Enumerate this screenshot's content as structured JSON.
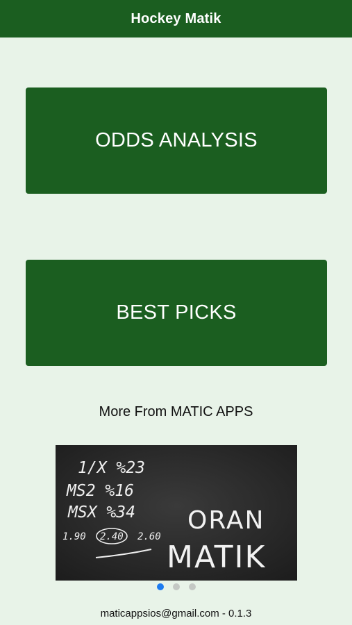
{
  "header": {
    "title": "Hockey Matik"
  },
  "menu": {
    "odds_label": "ODDS ANALYSIS",
    "picks_label": "BEST PICKS"
  },
  "promo": {
    "heading": "More From MATIC APPS",
    "banner_lines": [
      "1/X %23",
      "MS2 %16",
      "MSX %34",
      "1.90",
      "2.40",
      "2.60",
      "ORAN",
      "MATIK"
    ],
    "active_slide": 1,
    "slide_count": 3
  },
  "footer": {
    "text": "maticappsios@gmail.com - 0.1.3"
  },
  "colors": {
    "primary": "#1b5e20",
    "background": "#e8f3e8",
    "dot_active": "#1e7cf0",
    "dot_inactive": "#c4c8c4"
  }
}
